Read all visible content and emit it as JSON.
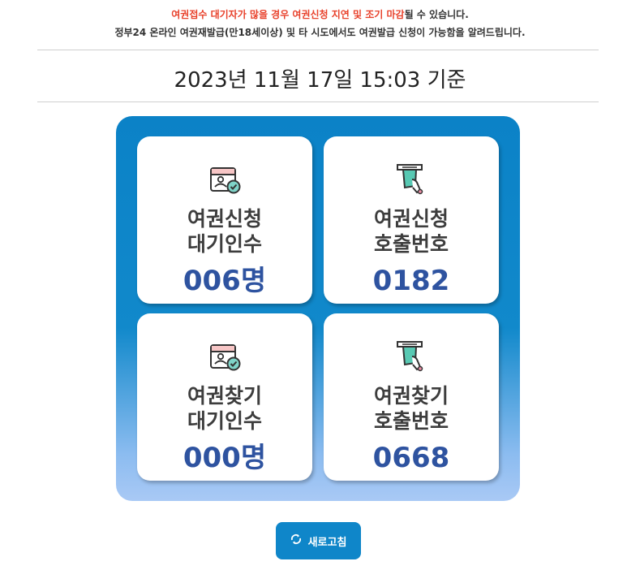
{
  "notice": {
    "line1_highlight": "여권접수 대기자가 많을 경우 여권신청 지연 및 조기 마감",
    "line1_rest": "될 수 있습니다.",
    "line2": "정부24 온라인 여권재발급(만18세이상) 및 타 시도에서도 여권발급 신청이 가능함을 알려드립니다."
  },
  "timestamp": "2023년 11월 17일 15:03 기준",
  "cards": [
    {
      "icon": "calendar-person-check-icon",
      "label_line1": "여권신청",
      "label_line2": "대기인수",
      "value": "006명"
    },
    {
      "icon": "ticket-dispenser-icon",
      "label_line1": "여권신청",
      "label_line2": "호출번호",
      "value": "0182"
    },
    {
      "icon": "calendar-person-check-icon",
      "label_line1": "여권찾기",
      "label_line2": "대기인수",
      "value": "000명"
    },
    {
      "icon": "ticket-dispenser-icon",
      "label_line1": "여권찾기",
      "label_line2": "호출번호",
      "value": "0668"
    }
  ],
  "refresh_button": {
    "label": "새로고침",
    "icon": "refresh-icon"
  },
  "colors": {
    "highlight_red": "#e8412b",
    "panel_blue": "#0b82c7",
    "value_blue": "#2e53a0",
    "button_blue": "#0f86c9"
  }
}
